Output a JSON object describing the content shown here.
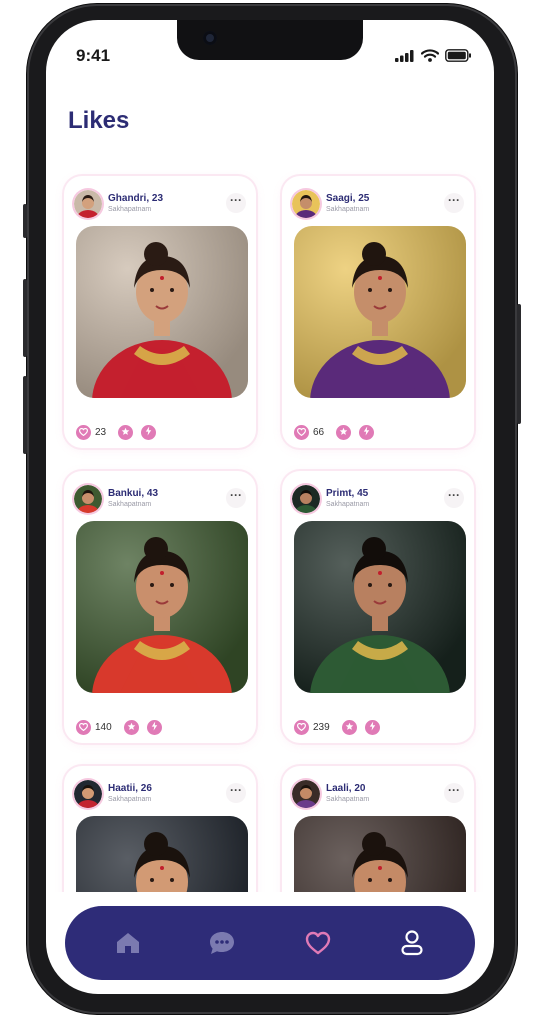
{
  "status": {
    "time": "9:41"
  },
  "page": {
    "title": "Likes"
  },
  "cards": [
    {
      "name": "Ghandri, 23",
      "location": "Sakhapatnam",
      "likes": "23",
      "photo": {
        "bg": "#c9b9a8",
        "dress": "#c4202e",
        "skin": "#d3a17d",
        "hair": "#2a1b14"
      }
    },
    {
      "name": "Saagi, 25",
      "location": "Sakhapatnam",
      "likes": "66",
      "photo": {
        "bg": "#e8c35a",
        "dress": "#5a2a7a",
        "skin": "#c58e6a",
        "hair": "#20150f"
      }
    },
    {
      "name": "Bankui, 43",
      "location": "Sakhapatnam",
      "likes": "140",
      "photo": {
        "bg": "#3e5a30",
        "dress": "#d8392c",
        "skin": "#c98f6c",
        "hair": "#1e140e"
      }
    },
    {
      "name": "Primt, 45",
      "location": "Sakhapatnam",
      "likes": "239",
      "photo": {
        "bg": "#1c2a24",
        "dress": "#2d5a34",
        "skin": "#b88060",
        "hair": "#120d0a"
      }
    },
    {
      "name": "Haatii, 26",
      "location": "Sakhapatnam",
      "likes": "",
      "photo": {
        "bg": "#222831",
        "dress": "#c32430",
        "skin": "#d29a74",
        "hair": "#1a120d"
      }
    },
    {
      "name": "Laali, 20",
      "location": "Sakhapatnam",
      "likes": "",
      "photo": {
        "bg": "#3a2c28",
        "dress": "#6a3a8a",
        "skin": "#c48a66",
        "hair": "#1b120d"
      }
    }
  ],
  "colors": {
    "accent": "#e07ab6",
    "navy": "#2e2c78",
    "title": "#2c2c74"
  },
  "nav": [
    {
      "icon": "home-icon",
      "active": false
    },
    {
      "icon": "chat-icon",
      "active": false
    },
    {
      "icon": "heart-icon",
      "active": true
    },
    {
      "icon": "profile-icon",
      "active": false
    }
  ]
}
